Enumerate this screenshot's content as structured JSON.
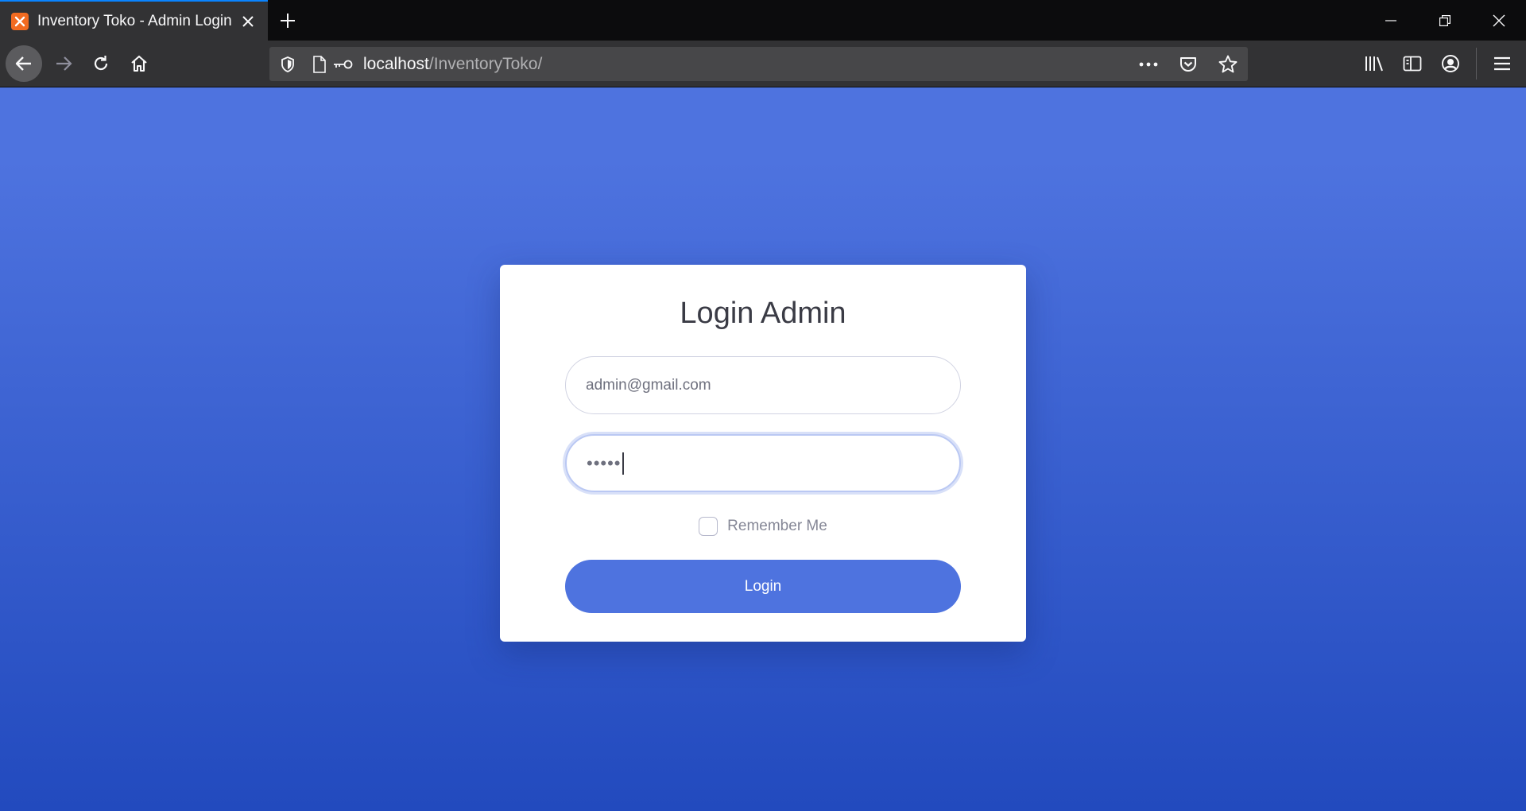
{
  "browser": {
    "tab": {
      "title": "Inventory Toko - Admin Login",
      "favicon": "xampp-icon"
    },
    "url": {
      "host": "localhost",
      "path": "/InventoryToko/"
    },
    "colors": {
      "tab_accent": "#0a84ff",
      "favicon": "#f26b21"
    }
  },
  "login": {
    "title": "Login Admin",
    "email_value": "admin@gmail.com",
    "password_mask": "•••••",
    "remember_label": "Remember Me",
    "remember_checked": false,
    "submit_label": "Login"
  },
  "colors": {
    "gradient_top": "#4e73df",
    "gradient_bottom": "#224abe",
    "button": "#4e73df",
    "card": "#ffffff"
  }
}
